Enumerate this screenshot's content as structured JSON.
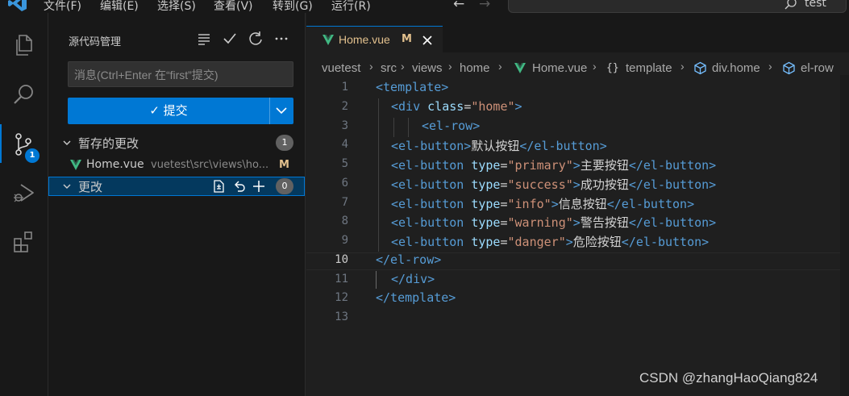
{
  "titlebar": {
    "menus": [
      "文件(F)",
      "编辑(E)",
      "选择(S)",
      "查看(V)",
      "转到(G)",
      "运行(R)"
    ],
    "search_text": "test",
    "brand_color": "#0078d4"
  },
  "activitybar": {
    "items": [
      "files-icon",
      "search-icon",
      "source-control-icon",
      "run-debug-icon",
      "extensions-icon"
    ],
    "scm_badge": "1"
  },
  "scm": {
    "title": "源代码管理",
    "message_placeholder": "消息(Ctrl+Enter 在“first”提交)",
    "commit_label": "✓ 提交",
    "staged": {
      "label": "暂存的更改",
      "count": "1",
      "files": [
        {
          "name": "Home.vue",
          "path": "vuetest\\src\\views\\ho...",
          "status": "M"
        }
      ]
    },
    "changes": {
      "label": "更改",
      "count": "0"
    }
  },
  "editor": {
    "tab": {
      "label": "Home.vue",
      "status": "M"
    },
    "breadcrumb": [
      "vuetest",
      "src",
      "views",
      "home",
      "Home.vue",
      "template",
      "div.home",
      "el-row"
    ],
    "active_line": 10,
    "line_numbers": [
      "1",
      "2",
      "3",
      "4",
      "5",
      "6",
      "7",
      "8",
      "9",
      "10",
      "11",
      "12",
      "13"
    ],
    "code": {
      "l1_tag": "<template>",
      "l2_open": "<div",
      "l2_attr": "class",
      "l2_eq": "=",
      "l2_val": "\"home\"",
      "l2_close": ">",
      "l3_tag": "<el-row>",
      "l4_open": "<el-button>",
      "l4_text": "默认按钮",
      "l4_close": "</el-button>",
      "buttons": [
        {
          "open": "<el-button",
          "attr": "type",
          "eq": "=",
          "val": "\"primary\"",
          "gt": ">",
          "text": "主要按钮",
          "close": "</el-button>"
        },
        {
          "open": "<el-button",
          "attr": "type",
          "eq": "=",
          "val": "\"success\"",
          "gt": ">",
          "text": "成功按钮",
          "close": "</el-button>"
        },
        {
          "open": "<el-button",
          "attr": "type",
          "eq": "=",
          "val": "\"info\"",
          "gt": ">",
          "text": "信息按钮",
          "close": "</el-button>"
        },
        {
          "open": "<el-button",
          "attr": "type",
          "eq": "=",
          "val": "\"warning\"",
          "gt": ">",
          "text": "警告按钮",
          "close": "</el-button>"
        },
        {
          "open": "<el-button",
          "attr": "type",
          "eq": "=",
          "val": "\"danger\"",
          "gt": ">",
          "text": "危险按钮",
          "close": "</el-button>"
        }
      ],
      "l10_tag": "</el-row>",
      "l11_tag": "</div>",
      "l12_tag": "</template>"
    }
  },
  "watermark": "CSDN @zhangHaoQiang824"
}
